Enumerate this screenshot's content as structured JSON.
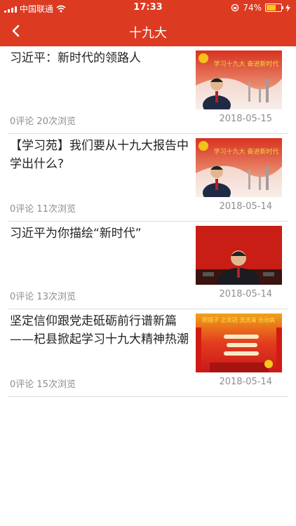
{
  "status_bar": {
    "carrier": "中国联通",
    "time": "17:33",
    "battery_percent_label": "74%",
    "battery_level": 0.74
  },
  "nav": {
    "title": "十九大",
    "back_icon": "chevron-left-icon"
  },
  "articles": [
    {
      "title": "习近平：新时代的领路人",
      "comments": "0评论",
      "views": "20次浏览",
      "date": "2018-05-15",
      "thumb_text": "学习十九大 奋进新时代"
    },
    {
      "title": "【学习苑】我们要从十九大报告中学出什么?",
      "comments": "0评论",
      "views": "11次浏览",
      "date": "2018-05-14",
      "thumb_text": "学习十九大 奋进新时代"
    },
    {
      "title": "习近平为你描绘“新时代”",
      "comments": "0评论",
      "views": "13次浏览",
      "date": "2018-05-14"
    },
    {
      "title": "坚定信仰跟党走砥砺前行谱新篇——杞县掀起学习十九大精神热潮",
      "comments": "0评论",
      "views": "15次浏览",
      "date": "2018-05-14",
      "thumb_text": "照镜子 正衣冠 洗洗澡 治治病"
    }
  ],
  "colors": {
    "accent": "#dd3a22",
    "meta_text": "#8e8e8e",
    "divider": "#dcdcdc"
  }
}
